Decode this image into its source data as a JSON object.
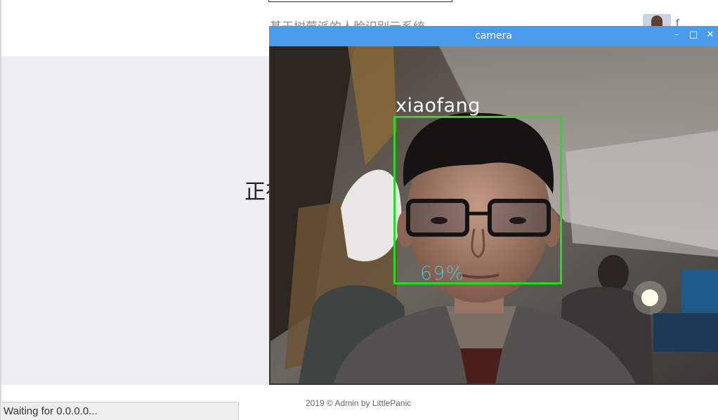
{
  "page": {
    "title_partial": "基于树莓派的人脸识别云系统",
    "user_initial": "f",
    "status_text_partial": "正在",
    "footer": "2019 © Admin by LittlePanic",
    "browser_status": "Waiting for 0.0.0.0..."
  },
  "camera_window": {
    "title": "camera",
    "minimize_glyph": "–",
    "maximize_glyph": "□",
    "close_glyph": "✕",
    "titlebar_color": "#4a9bec"
  },
  "detection": {
    "name": "xiaofang",
    "confidence_text": "69%",
    "confidence": 0.69,
    "box_color": "#22dd22"
  }
}
